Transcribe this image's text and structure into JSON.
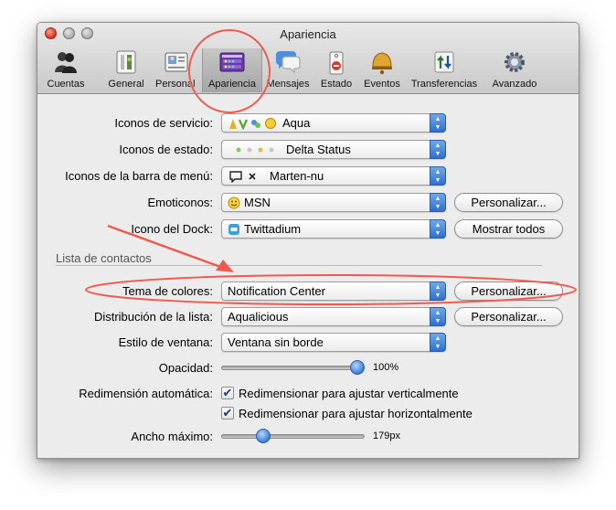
{
  "window": {
    "title": "Apariencia"
  },
  "toolbar": {
    "items": [
      {
        "label": "Cuentas",
        "icon": "accounts-icon"
      },
      {
        "label": "General",
        "icon": "general-icon"
      },
      {
        "label": "Personal",
        "icon": "personal-icon"
      },
      {
        "label": "Apariencia",
        "icon": "appearance-icon",
        "selected": true
      },
      {
        "label": "Mensajes",
        "icon": "messages-icon"
      },
      {
        "label": "Estado",
        "icon": "status-icon"
      },
      {
        "label": "Eventos",
        "icon": "events-icon"
      },
      {
        "label": "Transferencias",
        "icon": "transfers-icon"
      },
      {
        "label": "Avanzado",
        "icon": "advanced-icon"
      }
    ]
  },
  "form": {
    "service_icons": {
      "label": "Iconos de servicio:",
      "value": "Aqua"
    },
    "status_icons": {
      "label": "Iconos de estado:",
      "value": "Delta Status"
    },
    "menubar_icons": {
      "label": "Iconos de la barra de menú:",
      "value": "Marten-nu"
    },
    "emoticons": {
      "label": "Emoticonos:",
      "value": "MSN",
      "button": "Personalizar..."
    },
    "dock_icon": {
      "label": "Icono del Dock:",
      "value": "Twittadium",
      "button": "Mostrar todos"
    },
    "contact_list": {
      "section_label": "Lista de contactos"
    },
    "color_theme": {
      "label": "Tema de colores:",
      "value": "Notification Center",
      "button": "Personalizar..."
    },
    "list_layout": {
      "label": "Distribución de la lista:",
      "value": "Aqualicious",
      "button": "Personalizar..."
    },
    "window_style": {
      "label": "Estilo de ventana:",
      "value": "Ventana sin borde"
    },
    "opacity": {
      "label": "Opacidad:",
      "value_text": "100%",
      "level": 1.0
    },
    "autoresize": {
      "label": "Redimensión automática:",
      "vertical": {
        "label": "Redimensionar para ajustar verticalmente",
        "checked": true
      },
      "horizontal": {
        "label": "Redimensionar para ajustar horizontalmente",
        "checked": true
      }
    },
    "max_width": {
      "label": "Ancho máximo:",
      "value_text": "179px",
      "level": 0.27
    }
  },
  "annotations": {
    "color": "#ee5a4f"
  }
}
